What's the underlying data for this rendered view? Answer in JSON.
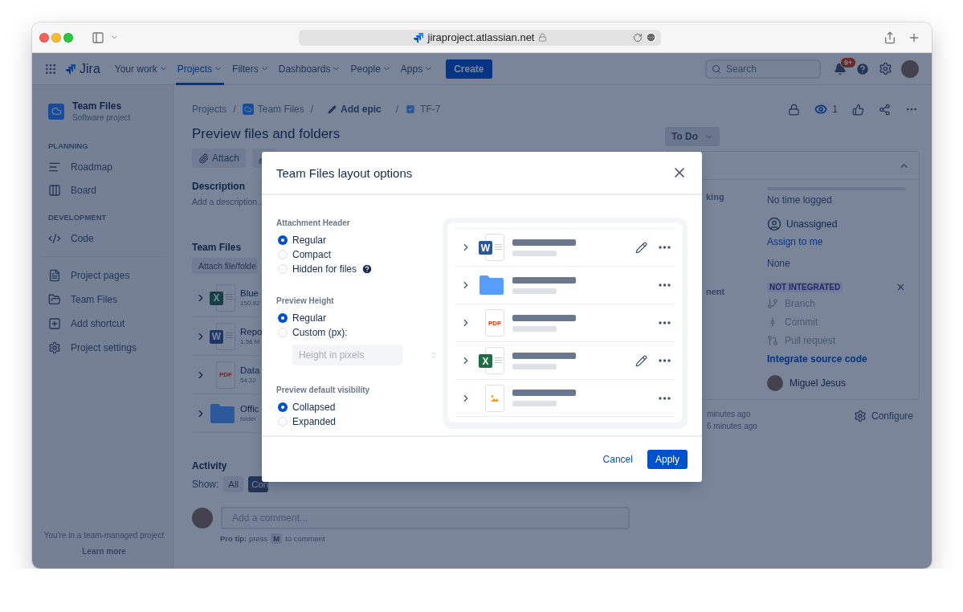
{
  "browser": {
    "url": "jiraproject.atlassian.net"
  },
  "nav": {
    "logo": "Jira",
    "items": [
      {
        "label": "Your work",
        "selected": false
      },
      {
        "label": "Projects",
        "selected": true
      },
      {
        "label": "Filters",
        "selected": false
      },
      {
        "label": "Dashboards",
        "selected": false
      },
      {
        "label": "People",
        "selected": false
      },
      {
        "label": "Apps",
        "selected": false
      }
    ],
    "create": "Create",
    "search": {
      "placeholder": "Search"
    },
    "notifications": "9+"
  },
  "sidebar": {
    "project": {
      "name": "Team Files",
      "type": "Software project"
    },
    "sections": [
      {
        "heading": "PLANNING",
        "items": [
          {
            "label": "Roadmap"
          },
          {
            "label": "Board"
          }
        ]
      },
      {
        "heading": "DEVELOPMENT",
        "items": [
          {
            "label": "Code"
          }
        ]
      }
    ],
    "links": [
      {
        "label": "Project pages"
      },
      {
        "label": "Team Files"
      },
      {
        "label": "Add shortcut"
      },
      {
        "label": "Project settings"
      }
    ],
    "footer": {
      "text": "You're in a team-managed project",
      "link": "Learn more"
    }
  },
  "issue": {
    "breadcrumbs": {
      "separator": "/",
      "items": [
        {
          "label": "Projects",
          "kind": "text"
        },
        {
          "label": "Team Files",
          "kind": "project"
        },
        {
          "label": "Add epic",
          "kind": "epic"
        },
        {
          "label": "TF-7",
          "kind": "task"
        }
      ]
    },
    "watchers": "1",
    "title": "Preview files and folders",
    "status": "To Do",
    "toolbar": [
      {
        "label": "Attach"
      }
    ],
    "description": {
      "heading": "Description",
      "placeholder": "Add a description.."
    },
    "team_files": {
      "heading": "Team Files",
      "attach": "Attach file/folde",
      "files": [
        {
          "kind": "excel",
          "badge": "X",
          "name": "Blue",
          "meta": "150.92"
        },
        {
          "kind": "word",
          "badge": "W",
          "name": "Repo",
          "meta": "1.56 M"
        },
        {
          "kind": "pdf",
          "badge": "PDF",
          "name": "Data",
          "meta": "54.22"
        },
        {
          "kind": "folder",
          "name": "Offic",
          "meta": "folder"
        }
      ]
    },
    "activity": {
      "heading": "Activity",
      "show": "Show:",
      "filters": [
        {
          "label": "All",
          "selected": false
        },
        {
          "label": "Con",
          "selected": true
        }
      ],
      "comment": {
        "placeholder": "Add a comment..."
      },
      "tip": {
        "lead": "**Pro tip:** press",
        "key": "M",
        "tail": "to comment"
      }
    }
  },
  "details": {
    "time_tracking": {
      "label": "king",
      "level": 0,
      "value": "No time logged"
    },
    "assignee": {
      "value": "Unassigned",
      "action": "Assign to me"
    },
    "field_3": {
      "value": "None"
    },
    "development": {
      "label": "nent",
      "status": "NOT INTEGRATED",
      "items": [
        "Branch",
        "Commit",
        "Pull request"
      ],
      "action": "Integrate source code"
    },
    "person": {
      "name": "Miguel Jesus"
    }
  },
  "timestamps": [
    "minutes ago",
    "6 minutes ago"
  ],
  "configure": "Configure",
  "modal": {
    "title": "Team Files layout options",
    "groups": [
      {
        "heading": "Attachment Header",
        "options": [
          {
            "label": "Regular",
            "selected": true,
            "help": false
          },
          {
            "label": "Compact",
            "selected": false,
            "help": false
          },
          {
            "label": "Hidden for files",
            "selected": false,
            "help": true
          }
        ]
      },
      {
        "heading": "Preview Height",
        "options": [
          {
            "label": "Regular",
            "selected": true,
            "help": false
          },
          {
            "label": "Custom (px):",
            "selected": false,
            "help": false
          }
        ],
        "input": {
          "placeholder": "Height in pixels",
          "disabled": true
        }
      },
      {
        "heading": "Preview default visibility",
        "options": [
          {
            "label": "Collapsed",
            "selected": true,
            "help": false
          },
          {
            "label": "Expanded",
            "selected": false,
            "help": false
          }
        ]
      }
    ],
    "preview": [
      {
        "kind": "word",
        "badge": "W",
        "editable": true
      },
      {
        "kind": "folder",
        "editable": false
      },
      {
        "kind": "pdf",
        "badge": "PDF",
        "editable": false
      },
      {
        "kind": "excel",
        "badge": "X",
        "editable": true
      },
      {
        "kind": "image",
        "editable": false
      }
    ],
    "cancel": "Cancel",
    "apply": "Apply"
  }
}
